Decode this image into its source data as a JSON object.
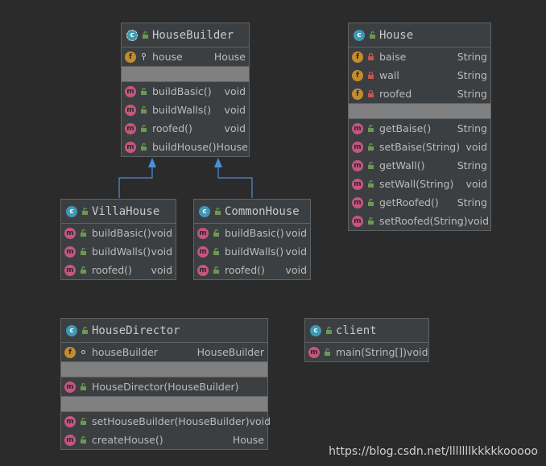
{
  "colors": {
    "background": "#2b2b2b",
    "box": "#3c3f41",
    "border": "#5f6264",
    "separator": "#808080",
    "class_icon": "#3f98b5",
    "field_icon": "#c48d2b",
    "method_icon": "#c6567d",
    "arrow": "#4a90d9"
  },
  "icons": {
    "class": "c",
    "field": "f",
    "method": "m"
  },
  "house_builder": {
    "title": "HouseBuilder",
    "fields": [
      {
        "name": "house",
        "type": "House"
      }
    ],
    "methods": [
      {
        "name": "buildBasic()",
        "type": "void"
      },
      {
        "name": "buildWalls()",
        "type": "void"
      },
      {
        "name": "roofed()",
        "type": "void"
      },
      {
        "name": "buildHouse()",
        "type": "House"
      }
    ]
  },
  "house": {
    "title": "House",
    "fields": [
      {
        "name": "baise",
        "type": "String"
      },
      {
        "name": "wall",
        "type": "String"
      },
      {
        "name": "roofed",
        "type": "String"
      }
    ],
    "methods": [
      {
        "name": "getBaise()",
        "type": "String"
      },
      {
        "name": "setBaise(String)",
        "type": "void"
      },
      {
        "name": "getWall()",
        "type": "String"
      },
      {
        "name": "setWall(String)",
        "type": "void"
      },
      {
        "name": "getRoofed()",
        "type": "String"
      },
      {
        "name": "setRoofed(String)",
        "type": "void"
      }
    ]
  },
  "villa_house": {
    "title": "VillaHouse",
    "methods": [
      {
        "name": "buildBasic()",
        "type": "void"
      },
      {
        "name": "buildWalls()",
        "type": "void"
      },
      {
        "name": "roofed()",
        "type": "void"
      }
    ]
  },
  "common_house": {
    "title": "CommonHouse",
    "methods": [
      {
        "name": "buildBasic()",
        "type": "void"
      },
      {
        "name": "buildWalls()",
        "type": "void"
      },
      {
        "name": "roofed()",
        "type": "void"
      }
    ]
  },
  "house_director": {
    "title": "HouseDirector",
    "fields": [
      {
        "name": "houseBuilder",
        "type": "HouseBuilder"
      }
    ],
    "constructors": [
      {
        "name": "HouseDirector(HouseBuilder)",
        "type": ""
      }
    ],
    "methods": [
      {
        "name": "setHouseBuilder(HouseBuilder)",
        "type": "void"
      },
      {
        "name": "createHouse()",
        "type": "House"
      }
    ]
  },
  "client": {
    "title": "client",
    "methods": [
      {
        "name": "main(String[])",
        "type": "void"
      }
    ]
  },
  "watermark": "https://blog.csdn.net/lllllllkkkkkooooo"
}
